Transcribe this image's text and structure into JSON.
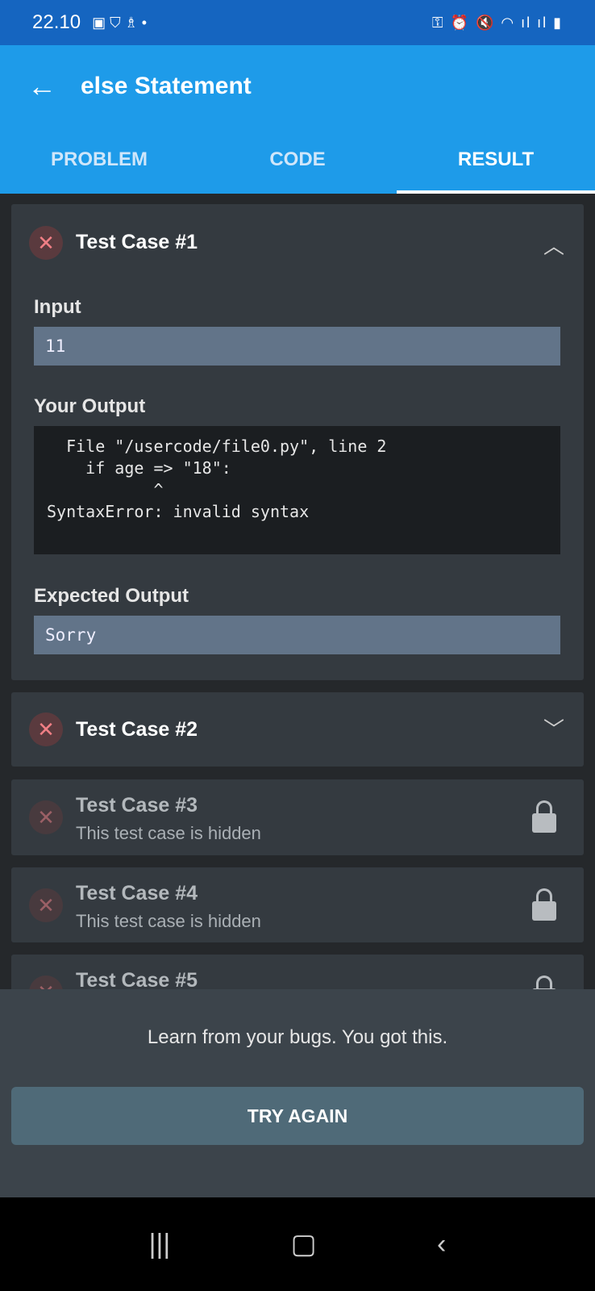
{
  "status": {
    "time": "22.10",
    "icons_left": "gallery-icon shield-icon notification-icon dot",
    "icons_right": "key-icon alarm-icon mute-icon wifi-icon signal-icon battery-icon"
  },
  "appbar": {
    "title": "else Statement"
  },
  "tabs": [
    {
      "label": "PROBLEM"
    },
    {
      "label": "CODE"
    },
    {
      "label": "RESULT",
      "active": true
    }
  ],
  "cases": [
    {
      "title": "Test Case #1",
      "status": "failed",
      "expanded": true,
      "input_label": "Input",
      "input": "11",
      "output_label": "Your Output",
      "output": "  File \"/usercode/file0.py\", line 2\n    if age => \"18\":\n           ^\nSyntaxError: invalid syntax",
      "expected_label": "Expected Output",
      "expected": "Sorry"
    },
    {
      "title": "Test Case #2",
      "status": "failed"
    },
    {
      "title": "Test Case #3",
      "subtitle": "This test case is hidden",
      "locked": true
    },
    {
      "title": "Test Case #4",
      "subtitle": "This test case is hidden",
      "locked": true
    },
    {
      "title": "Test Case #5",
      "locked": true
    }
  ],
  "footer": {
    "message": "Learn from your bugs. You got this.",
    "button": "TRY AGAIN"
  },
  "colors": {
    "status_bar": "#1565c0",
    "app_bar": "#1e9be9",
    "fail": "#f07f85",
    "button": "#4f6a78"
  }
}
